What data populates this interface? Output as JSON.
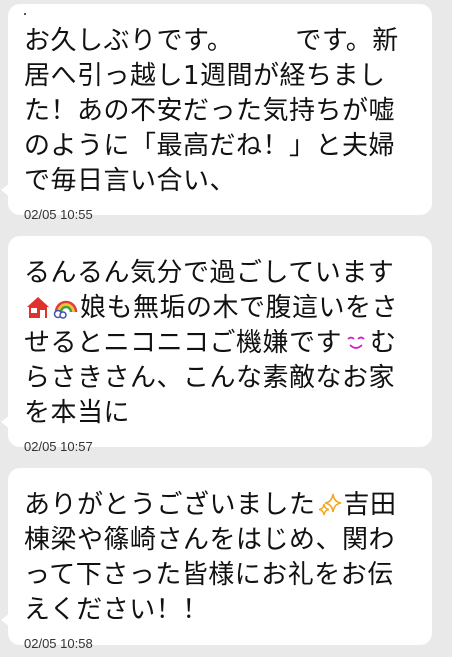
{
  "messages": [
    {
      "text_parts": [
        "お久しぶりです。",
        "です。新居へ引っ越し1週間が経ちました！あの不安だった気持ちが嘘のように「最高だね！」と夫婦で毎日言い合い、"
      ],
      "time": "02/05 10:55"
    },
    {
      "text_parts": [
        "るんるん気分で過ごしています",
        "娘も無垢の木で腹這いをさせるとニコニコご機嫌です",
        "むらさきさん、こんな素敵なお家を本当に"
      ],
      "icons": [
        "house-emoji-icon",
        "rainbow-emoji-icon",
        "smiling-face-emoji-icon"
      ],
      "time": "02/05 10:57"
    },
    {
      "text_parts": [
        "ありがとうございました",
        "吉田棟梁や篠崎さんをはじめ、関わって下さった皆様にお礼をお伝えください！！"
      ],
      "icons": [
        "sparkles-emoji-icon"
      ],
      "time": "02/05 10:58"
    }
  ],
  "colors": {
    "background": "#e9e9e9",
    "bubble": "#ffffff",
    "text": "#111111",
    "time": "#333333"
  }
}
